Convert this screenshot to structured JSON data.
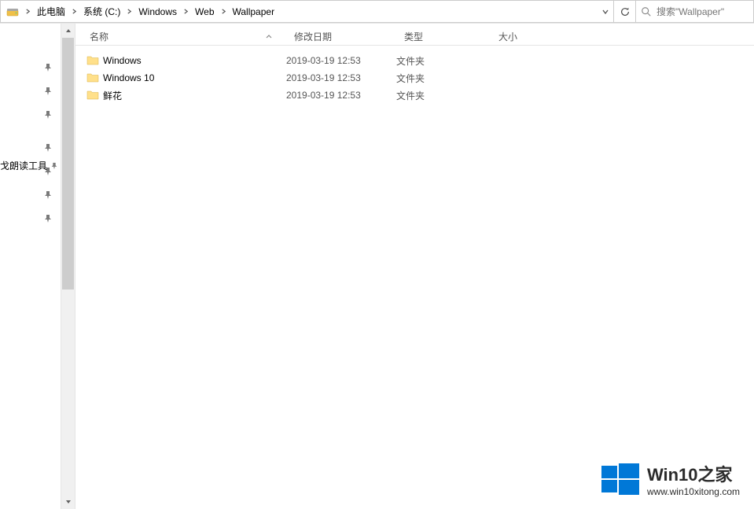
{
  "breadcrumb": {
    "items": [
      {
        "label": "此电脑"
      },
      {
        "label": "系统 (C:)"
      },
      {
        "label": "Windows"
      },
      {
        "label": "Web"
      },
      {
        "label": "Wallpaper"
      }
    ]
  },
  "search": {
    "placeholder": "搜索\"Wallpaper\""
  },
  "columns": {
    "name": "名称",
    "date": "修改日期",
    "type": "类型",
    "size": "大小"
  },
  "sidebar": {
    "text_item": "戈朗读工具"
  },
  "files": [
    {
      "name": "Windows",
      "date": "2019-03-19 12:53",
      "type": "文件夹",
      "size": ""
    },
    {
      "name": "Windows 10",
      "date": "2019-03-19 12:53",
      "type": "文件夹",
      "size": ""
    },
    {
      "name": "鲜花",
      "date": "2019-03-19 12:53",
      "type": "文件夹",
      "size": ""
    }
  ],
  "watermark": {
    "title": "Win10之家",
    "url": "www.win10xitong.com"
  }
}
